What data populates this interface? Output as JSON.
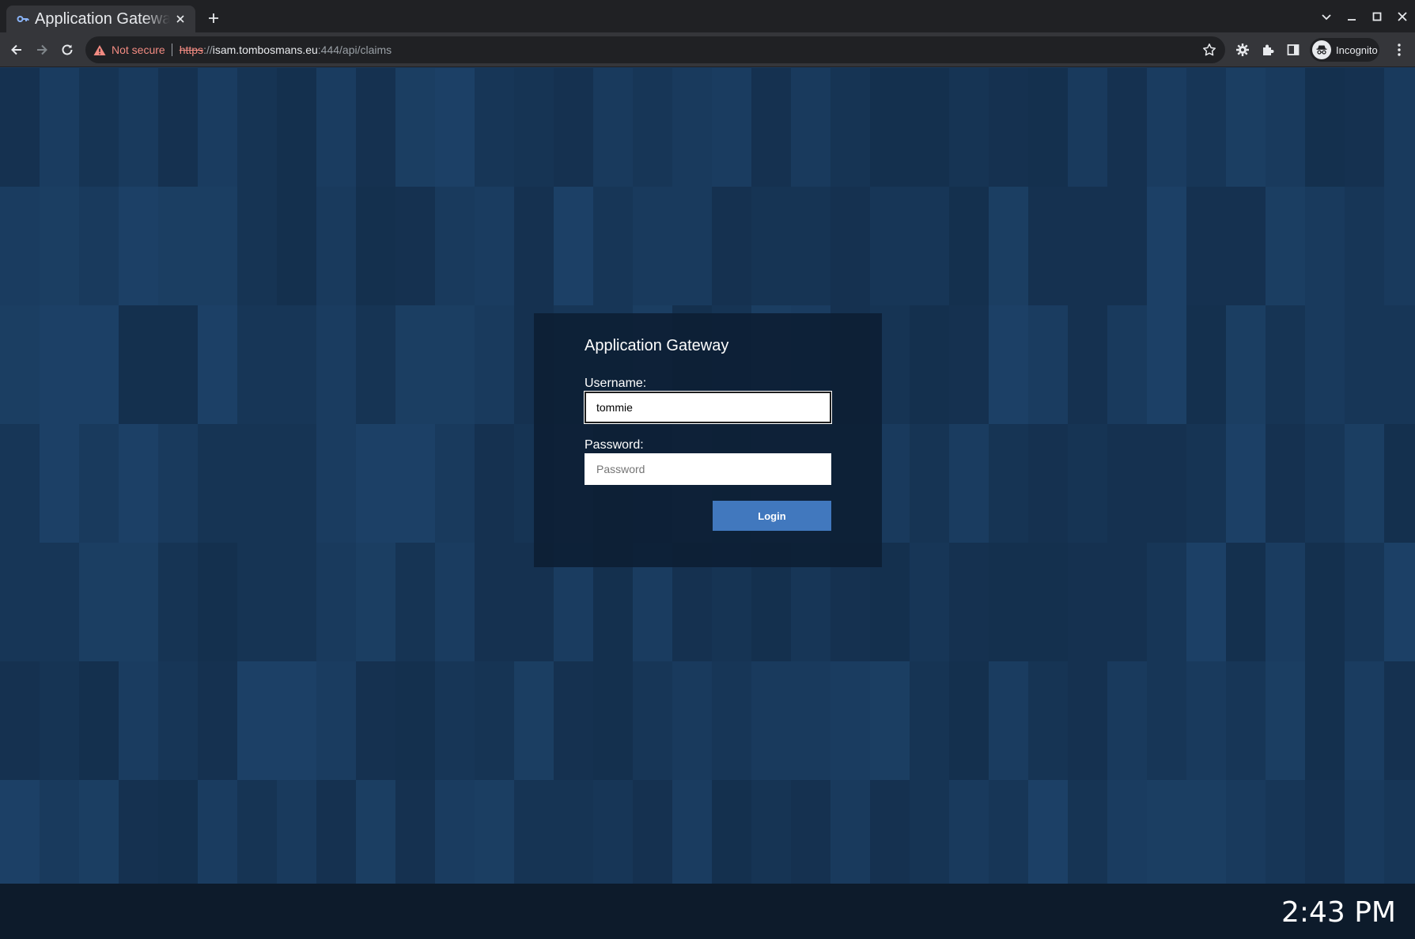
{
  "browser": {
    "tab": {
      "title": "Application Gateway",
      "favicon": "key-icon",
      "close_icon": "close-icon"
    },
    "new_tab_icon": "plus-icon",
    "window_controls": [
      "tab-search-icon",
      "minimize-icon",
      "maximize-icon",
      "close-icon"
    ],
    "omnibox": {
      "security_label": "Not secure",
      "url_scheme": "https",
      "url_separator": "://",
      "url_host": "isam.tombosmans.eu",
      "url_rest": ":444/api/claims"
    },
    "profile": {
      "label": "Incognito"
    }
  },
  "login": {
    "title": "Application Gateway",
    "username_label": "Username:",
    "username_value": "tommie",
    "password_label": "Password:",
    "password_placeholder": "Password",
    "submit_label": "Login"
  },
  "colors": {
    "primary_button": "#4178be",
    "card_background": "#0d1f35",
    "page_background": "#1b3a5c",
    "not_secure": "#f28b82"
  },
  "taskbar": {
    "clock": "2:43 PM"
  }
}
